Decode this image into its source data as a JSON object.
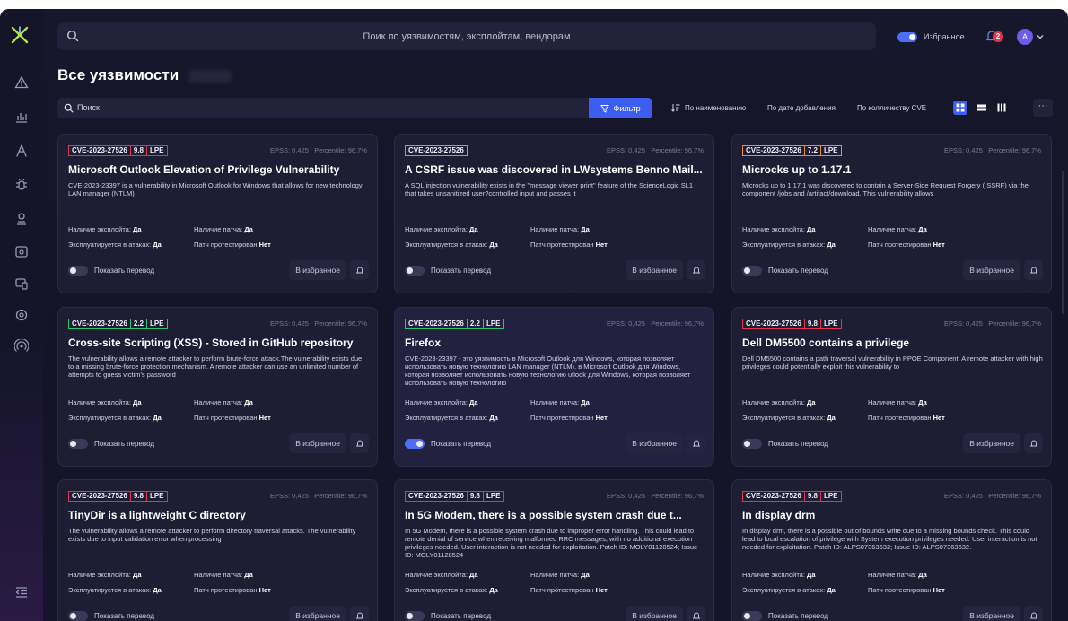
{
  "topbar": {
    "search_placeholder": "Поик по уязвимостям, эксплойтам, вендорам",
    "favorites_label": "Избранное",
    "notifications_count": "2",
    "avatar_initial": "А"
  },
  "page": {
    "title": "Все уязвимости"
  },
  "toolbar": {
    "search_placeholder": "Поиск",
    "filter_label": "Фильтр",
    "sort_options": [
      "По наименованию",
      "По дате добавления",
      "По колличеству CVE"
    ],
    "more_label": "···"
  },
  "labels": {
    "exploit": "Наличие эксплойта:",
    "patch": "Наличие патча:",
    "attacks": "Эксплуатируется в атаках:",
    "tested": "Патч протестирован",
    "translate": "Показать перевод",
    "favorite": "В избранное"
  },
  "cards": [
    {
      "cve": "CVE-2023-27526",
      "score": "9.8",
      "tag": "LPE",
      "severity": "red",
      "epss": "EPSS: 0,425",
      "percentile": "Percentile: 96,7%",
      "title": "Microsoft Outlook Elevation of Privilege Vulnerability",
      "desc": "CVE-2023-23397 is a vulnerability in Microsoft Outlook for Windows that allows for new technology LAN manager (NTLM)",
      "exploit": "Да",
      "patch": "Да",
      "attacks": "Да",
      "tested": "Нет",
      "translation_on": false
    },
    {
      "cve": "CVE-2023-27526",
      "score": "",
      "tag": "",
      "severity": "gray",
      "epss": "EPSS: 0,425",
      "percentile": "Percentile: 96,7%",
      "title": "A CSRF issue was discovered in LWsystems Benno Mail...",
      "desc": "A SQL injection vulnerability exists in the \"message viewer print\" feature of the ScienceLogic SL1 that takes unsanitized user?controlled input and passes it",
      "exploit": "Да",
      "patch": "Да",
      "attacks": "Да",
      "tested": "Нет",
      "translation_on": false
    },
    {
      "cve": "CVE-2023-27526",
      "score": "7.2",
      "tag": "LPE",
      "severity": "orange",
      "epss": "EPSS: 0,425",
      "percentile": "Percentile: 96,7%",
      "title": "Microcks up to 1.17.1",
      "desc": "Microcks up to 1.17.1 was discovered to contain a Server-Side Request Forgery ( SSRF) via the component /jobs and /artifact/download. This vulnerability allows",
      "exploit": "Да",
      "patch": "Да",
      "attacks": "Да",
      "tested": "Нет",
      "translation_on": false
    },
    {
      "cve": "CVE-2023-27526",
      "score": "2.2",
      "tag": "LPE",
      "severity": "green",
      "epss": "EPSS: 0,425",
      "percentile": "Percentile: 96,7%",
      "title": "Cross-site Scripting (XSS) - Stored in GitHub repository",
      "desc": "The vulnerability allows a remote attacker to perform brute-force attack.The vulnerability exists due to a missing brute-force protection mechanism. A remote attacker can use an unlimited number of attempts to guess victim's password",
      "exploit": "Да",
      "patch": "Да",
      "attacks": "Да",
      "tested": "Нет",
      "translation_on": false
    },
    {
      "cve": "CVE-2023-27526",
      "score": "2.2",
      "tag": "LPE",
      "severity": "green",
      "epss": "EPSS: 0,425",
      "percentile": "Percentile: 96,7%",
      "title": "Firefox",
      "desc": "CVE-2023-23397 - это уязвимость в Microsoft Outlook для Windows, которая позволяет использовать новую технологию LAN manager (NTLM). в Microsoft Outlook для Windows, которая позволяет использовать новую технологию utlook для Windows, которая позволяет использовать новую технологию",
      "exploit": "Да",
      "patch": "Да",
      "attacks": "Да",
      "tested": "Нет",
      "translation_on": true
    },
    {
      "cve": "CVE-2023-27526",
      "score": "9.8",
      "tag": "LPE",
      "severity": "red",
      "epss": "EPSS: 0,425",
      "percentile": "Percentile: 96,7%",
      "title": "Dell DM5500 contains a privilege",
      "desc": "Dell DM5500 contains a path traversal vulnerability in PPOE Component. A remote attacker with high privileges could potentially exploit this vulnerability to",
      "exploit": "Да",
      "patch": "Да",
      "attacks": "Да",
      "tested": "Нет",
      "translation_on": false
    },
    {
      "cve": "CVE-2023-27526",
      "score": "9.8",
      "tag": "LPE",
      "severity": "red",
      "epss": "EPSS: 0,425",
      "percentile": "Percentile: 96,7%",
      "title": "TinyDir is a lightweight C directory",
      "desc": "The vulnerability allows a remote attacker to perform directory traversal attacks. The vulnerability exists due to input validation error when processing",
      "exploit": "Да",
      "patch": "Да",
      "attacks": "Да",
      "tested": "Нет",
      "translation_on": false
    },
    {
      "cve": "CVE-2023-27526",
      "score": "9.8",
      "tag": "LPE",
      "severity": "red",
      "epss": "EPSS: 0,425",
      "percentile": "Percentile: 96,7%",
      "title": "In 5G Modem, there is a possible system crash due t...",
      "desc": "In 5G Modem, there is a possible system crash due to improper error handling. This could lead to remote denial of service when receiving malformed RRC messages, with no additional execution privileges needed. User interaction is not needed for exploitation. Patch ID: MOLY01128524; Issue ID: MOLY01128524",
      "exploit": "Да",
      "patch": "Да",
      "attacks": "Да",
      "tested": "Нет",
      "translation_on": false
    },
    {
      "cve": "CVE-2023-27526",
      "score": "9.8",
      "tag": "LPE",
      "severity": "red",
      "epss": "EPSS: 0,425",
      "percentile": "Percentile: 96,7%",
      "title": "In display drm",
      "desc": "In display drm, there is a possible out of bounds write due to a missing bounds check. This could lead to local escalation of privilege with System execution privileges needed. User interaction is not needed for exploitation. Patch ID: ALPS07363632; Issue ID: ALPS07363632.",
      "exploit": "Да",
      "patch": "Да",
      "attacks": "Да",
      "tested": "Нет",
      "translation_on": false
    }
  ],
  "colors": {
    "accent": "#3d5cf0",
    "severity_red": "#e5334b",
    "severity_orange": "#f08a2a",
    "severity_green": "#2cc76a"
  }
}
